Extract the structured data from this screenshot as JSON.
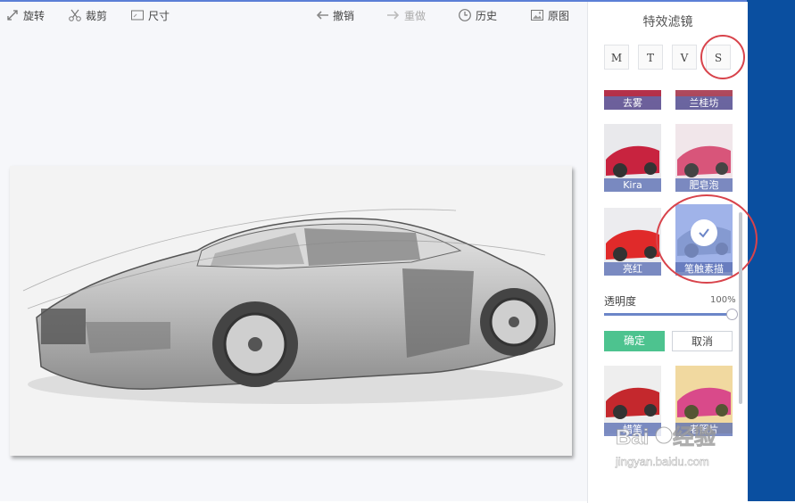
{
  "toolbar": {
    "rotate": "旋转",
    "crop": "裁剪",
    "size": "尺寸",
    "undo": "撤销",
    "redo": "重做",
    "history": "历史",
    "original": "原图"
  },
  "panel": {
    "title": "特效滤镜",
    "categories": [
      "M",
      "T",
      "V",
      "S"
    ],
    "filters": [
      {
        "label": "去雾"
      },
      {
        "label": "兰桂坊"
      },
      {
        "label": "Kira"
      },
      {
        "label": "肥皂泡"
      },
      {
        "label": "亮红"
      },
      {
        "label": "笔触素描"
      },
      {
        "label": "蜡笔"
      },
      {
        "label": "老照片"
      }
    ],
    "opacity_label": "透明度",
    "opacity_value": "100%",
    "opacity_fraction": 1.0,
    "confirm": "确定",
    "cancel": "取消"
  },
  "watermark": {
    "logo": "Baidu经验",
    "url": "jingyan.baidu.com"
  },
  "colors": {
    "accent": "#5b7fd6",
    "confirm": "#4dc38f",
    "annotation": "#d8434b",
    "selected_overlay": "#7896eb"
  }
}
